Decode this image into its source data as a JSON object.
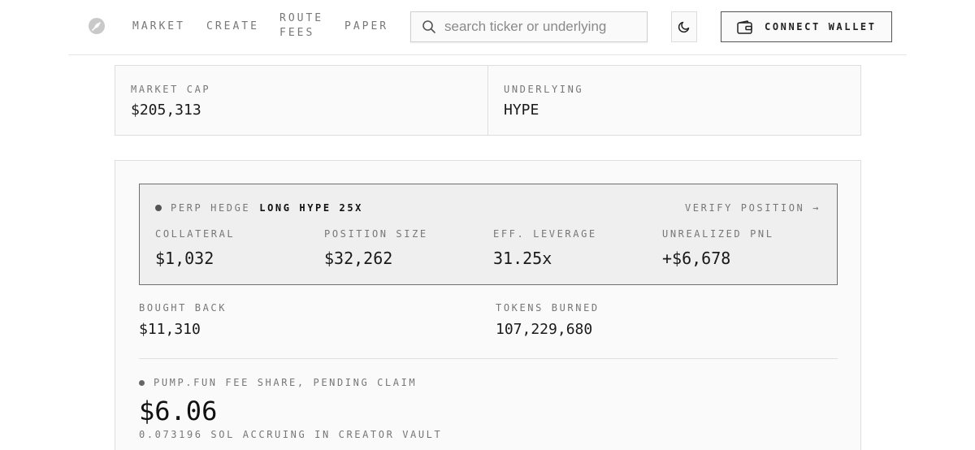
{
  "nav": {
    "items": [
      {
        "label": "MARKET"
      },
      {
        "label": "CREATE"
      },
      {
        "label": "ROUTE FEES"
      },
      {
        "label": "PAPER"
      }
    ]
  },
  "search": {
    "placeholder": "search ticker or underlying",
    "value": ""
  },
  "wallet": {
    "label": "CONNECT WALLET"
  },
  "icons": {
    "logo": "feather-logo-icon",
    "search": "search-icon",
    "theme": "moon-icon",
    "wallet": "wallet-icon"
  },
  "info": {
    "market_cap": {
      "label": "MARKET CAP",
      "value": "$205,313"
    },
    "underlying": {
      "label": "UNDERLYING",
      "value": "HYPE"
    }
  },
  "hedge": {
    "tag": "PERP HEDGE",
    "position": "LONG HYPE 25X",
    "verify_label": "VERIFY POSITION →",
    "stats": [
      {
        "label": "COLLATERAL",
        "value": "$1,032"
      },
      {
        "label": "POSITION SIZE",
        "value": "$32,262"
      },
      {
        "label": "EFF. LEVERAGE",
        "value": "31.25x"
      },
      {
        "label": "UNREALIZED PNL",
        "value": "+$6,678"
      }
    ]
  },
  "bought_back": {
    "label": "BOUGHT BACK",
    "value": "$11,310"
  },
  "tokens_burned": {
    "label": "TOKENS BURNED",
    "value": "107,229,680"
  },
  "fee_share": {
    "label": "PUMP.FUN FEE SHARE, PENDING CLAIM",
    "value": "$6.06",
    "sub": "0.073196 SOL ACCRUING IN CREATOR VAULT"
  }
}
